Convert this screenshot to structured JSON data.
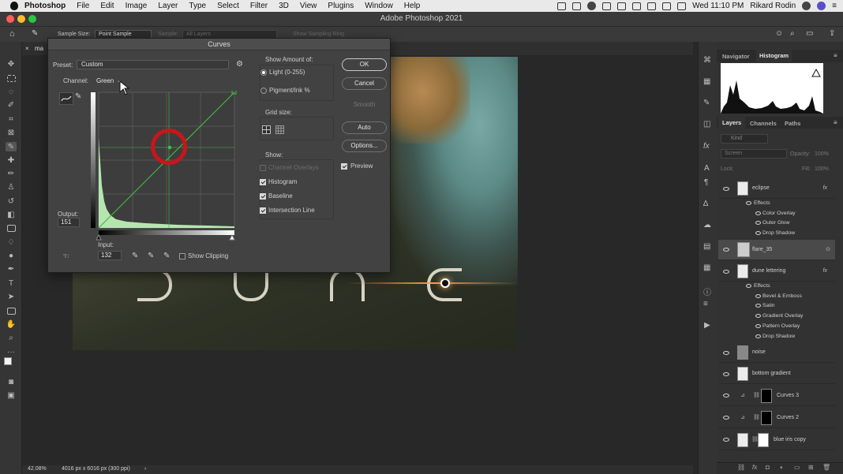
{
  "menubar": {
    "app_name": "Photoshop",
    "items": [
      "File",
      "Edit",
      "Image",
      "Layer",
      "Type",
      "Select",
      "Filter",
      "3D",
      "View",
      "Plugins",
      "Window",
      "Help"
    ],
    "clock": "Wed 11:10 PM",
    "user": "Rikard Rodin"
  },
  "window": {
    "title": "Adobe Photoshop 2021"
  },
  "options_bar": {
    "sample_size_label": "Sample Size:",
    "sample_size_value": "Point Sample",
    "sample_label": "Sample:",
    "sample_value": "All Layers",
    "show_ring_label": "Show Sampling Ring"
  },
  "document": {
    "tab_name": "ma"
  },
  "canvas": {
    "letters": [
      "D",
      "U",
      "N",
      "E"
    ]
  },
  "status": {
    "zoom": "42.08%",
    "doc_info": "4016 px x 6016 px (300 ppi)"
  },
  "panels": {
    "top_tabs": [
      "Navigator",
      "Histogram"
    ],
    "active_top_tab": "Histogram",
    "layer_tabs": [
      "Layers",
      "Channels",
      "Paths"
    ],
    "active_layer_tab": "Layers",
    "kind_placeholder": "Kind",
    "blend_mode": "Screen",
    "opacity_label": "Opacity:",
    "opacity_value": "100%",
    "lock_label": "Lock:",
    "fill_label": "Fill:",
    "fill_value": "100%"
  },
  "layers": [
    {
      "name": "eclipse",
      "fx": true,
      "effects_label": "Effects",
      "effects": [
        "Color Overlay",
        "Outer Glow",
        "Drop Shadow"
      ]
    },
    {
      "name": "flare_35",
      "selected": true
    },
    {
      "name": "dune lettering",
      "fx": true,
      "effects_label": "Effects",
      "effects": [
        "Bevel & Emboss",
        "Satin",
        "Gradient Overlay",
        "Pattern Overlay",
        "Drop Shadow"
      ]
    },
    {
      "name": "noise"
    },
    {
      "name": "bottom gradient"
    },
    {
      "name": "Curves 3"
    },
    {
      "name": "Curves 2"
    },
    {
      "name": "blue iris copy"
    }
  ],
  "fx_symbol": "fx",
  "curves": {
    "title": "Curves",
    "preset_label": "Preset:",
    "preset_value": "Custom",
    "channel_label": "Channel:",
    "channel_value": "Green",
    "output_label": "Output:",
    "output_value": "151",
    "input_label": "Input:",
    "input_value": "132",
    "show_clipping_label": "Show Clipping",
    "show_amount_label": "Show Amount of:",
    "light_label": "Light  (0-255)",
    "pigment_label": "Pigment/Ink %",
    "grid_size_label": "Grid size:",
    "show_label": "Show:",
    "show_options": [
      "Channel Overlays",
      "Histogram",
      "Baseline",
      "Intersection Line"
    ],
    "buttons": {
      "ok": "OK",
      "cancel": "Cancel",
      "smooth": "Smooth",
      "auto": "Auto",
      "options": "Options..."
    },
    "preview_label": "Preview",
    "curve_color": "#3fbf3f"
  },
  "icons": [
    "apple-icon",
    "home-icon",
    "eyedropper-icon",
    "search-icon",
    "wifi-icon",
    "bluetooth-icon",
    "battery-icon",
    "eye-icon",
    "gear-icon"
  ]
}
